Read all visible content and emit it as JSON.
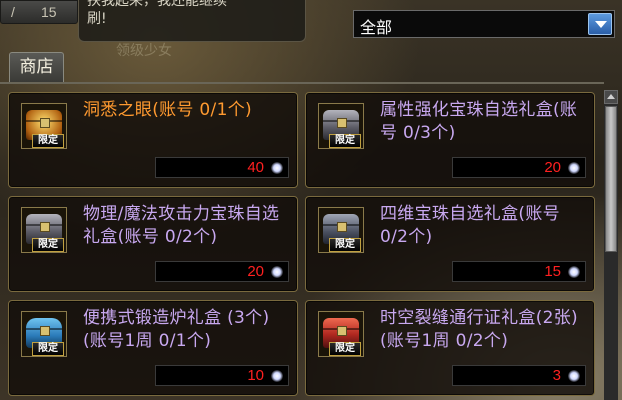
{
  "header": {
    "counter_left": "/",
    "counter_value": "15",
    "chat_line1": "扶我起来，我还能继续",
    "chat_line2": "刷!",
    "bg_caption": "领级少女",
    "filter_value": "全部"
  },
  "tabs": [
    {
      "label": "商店"
    }
  ],
  "items": [
    {
      "name": "洞悉之眼(账号 0/1个)",
      "tag": "限定",
      "price": "40",
      "icon": "gold-box-icon"
    },
    {
      "name": "属性强化宝珠自选礼盒(账号 0/3个)",
      "tag": "限定",
      "price": "20",
      "icon": "silver-box-icon"
    },
    {
      "name": "物理/魔法攻击力宝珠自选礼盒(账号 0/2个)",
      "tag": "限定",
      "price": "20",
      "icon": "silver-box-icon"
    },
    {
      "name": "四维宝珠自选礼盒(账号 0/2个)",
      "tag": "限定",
      "price": "15",
      "icon": "steel-box-icon"
    },
    {
      "name": "便携式锻造炉礼盒 (3个)(账号1周 0/1个)",
      "tag": "限定",
      "price": "10",
      "icon": "blue-box-icon"
    },
    {
      "name": "时空裂缝通行证礼盒(2张)(账号1周 0/2个)",
      "tag": "限定",
      "price": "3",
      "icon": "red-box-icon"
    }
  ],
  "colors": {
    "name_default": "#c8a8f0",
    "name_highlight": "#ff9a30",
    "price": "#ff2020",
    "dropdown_arrow": "#2a5ea8"
  }
}
